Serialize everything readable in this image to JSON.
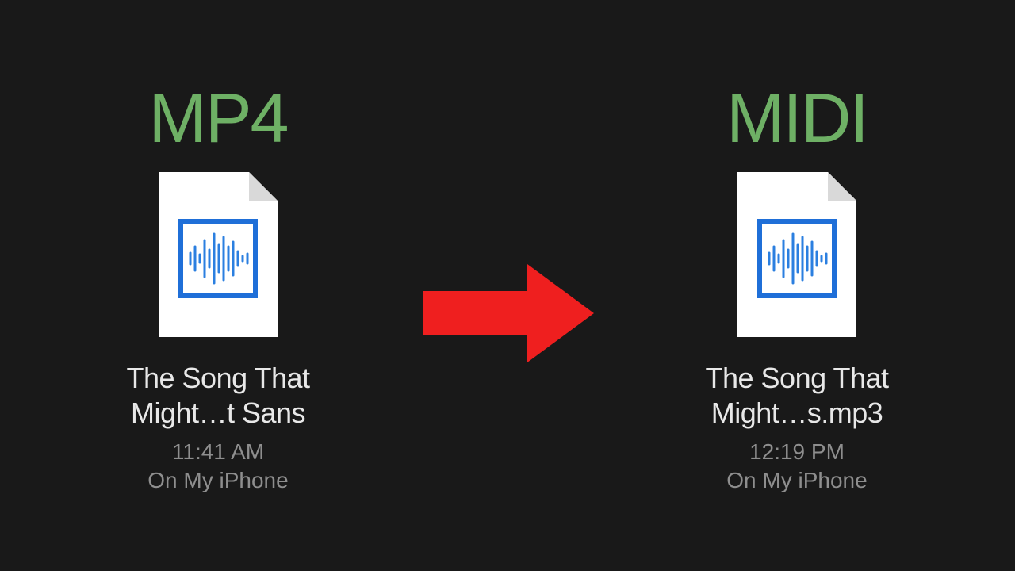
{
  "left": {
    "heading": "MP4",
    "file_name": "The Song That Might…t Sans",
    "time": "11:41 AM",
    "location": "On My iPhone"
  },
  "right": {
    "heading": "MIDI",
    "file_name": "The Song That Might…s.mp3",
    "time": "12:19 PM",
    "location": "On My iPhone"
  },
  "colors": {
    "heading": "#6EB065",
    "arrow": "#EF1F1F",
    "icon_outline": "#1F6FD8"
  }
}
